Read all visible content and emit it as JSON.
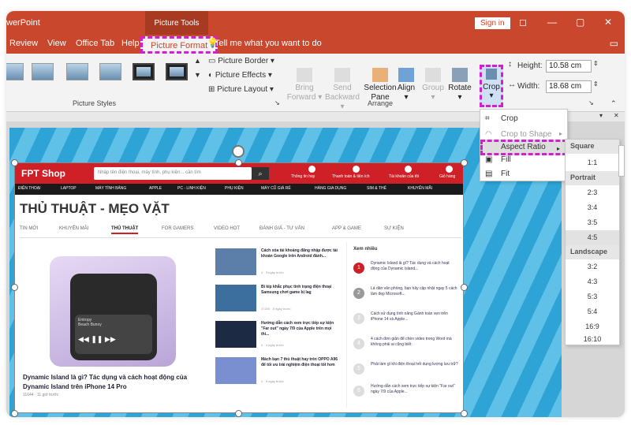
{
  "titlebar": {
    "app": "werPoint",
    "picture_tools": "Picture Tools",
    "sign_in": "Sign in",
    "restore_icon": "◻",
    "minimize_icon": "—",
    "maximize_icon": "▢",
    "close_icon": "✕"
  },
  "tabs": [
    {
      "label": "Review"
    },
    {
      "label": "View"
    },
    {
      "label": "Office Tab"
    },
    {
      "label": "Help"
    },
    {
      "label": "Picture Format"
    }
  ],
  "tell_me": "Tell me what you want to do",
  "ribbon": {
    "picture_border": "Picture Border",
    "picture_effects": "Picture Effects",
    "picture_layout": "Picture Layout",
    "picture_styles_label": "Picture Styles",
    "bring_forward": "Bring",
    "bring_forward_2": "Forward",
    "send_backward": "Send",
    "send_backward_2": "Backward",
    "selection_pane": "Selection",
    "selection_pane_2": "Pane",
    "align": "Align",
    "group": "Group",
    "rotate": "Rotate",
    "arrange_label": "Arrange",
    "crop": "Crop",
    "height_label": "Height:",
    "height_value": "10.58 cm",
    "width_label": "Width:",
    "width_value": "18.68 cm"
  },
  "crop_menu": {
    "crop": "Crop",
    "crop_to_shape": "Crop to Shape",
    "aspect_ratio": "Aspect Ratio",
    "fill": "Fill",
    "fit": "Fit"
  },
  "ratio_menu": {
    "square_header": "Square",
    "square": [
      "1:1"
    ],
    "portrait_header": "Portrait",
    "portrait": [
      "2:3",
      "3:4",
      "3:5",
      "4:5"
    ],
    "landscape_header": "Landscape",
    "landscape": [
      "3:2",
      "4:3",
      "5:3",
      "5:4",
      "16:9",
      "16:10"
    ]
  },
  "site": {
    "logo": "FPT Shop",
    "search_placeholder": "Nhập tên điện thoại, máy tính, phụ kiện... cần tìm",
    "header_links": [
      "Thông tin hay",
      "Thanh toán & tiện ích",
      "Tài khoản của tôi",
      "Giỏ hàng"
    ],
    "nav": [
      "ĐIỆN THOẠI",
      "LAPTOP",
      "MÁY TÍNH BẢNG",
      "APPLE",
      "PC - LINH KIỆN",
      "PHỤ KIỆN",
      "MÁY CŨ GIÁ RẺ",
      "HÀNG GIA DỤNG",
      "SIM & THẺ",
      "KHUYẾN MÃI"
    ],
    "title": "THỦ THUẬT - MẸO VẶT",
    "tabs": [
      "TIN MỚI",
      "KHUYẾN MÃI",
      "THỦ THUẬT",
      "FOR GAMERS",
      "VIDEO HOT",
      "ĐÁNH GIÁ - TƯ VẤN",
      "APP & GAME",
      "SỰ KIỆN"
    ],
    "main_caption": "Dynamic Island là gì? Tác dụng và cách hoạt động của Dynamic Island trên iPhone 14 Pro",
    "main_meta": "11644 · 11 giờ trước",
    "phone_track": "Entropy",
    "phone_artist": "Beach Bunny",
    "mid_articles": [
      {
        "title": "Cách xóa tài khoảng đăng nhập được tài khoản Google trên Android đánh...",
        "meta": "4 · 3 ngày trước"
      },
      {
        "title": "Bí kíp khắc phục tình trạng điện thoại Samsung chơi game bị lag",
        "meta": "47200 · 8 ngày trước"
      },
      {
        "title": "Hướng dẫn cách xem trực tiếp sự kiện \"Far out\" ngày 7/9 của Apple trên mọi thi...",
        "meta": "4 · 4 ngày trước"
      },
      {
        "title": "Mách bạn 7 thủ thuật hay trên OPPO A96 để tối ưu trải nghiệm điện thoại tốt hơn",
        "meta": "4 · 5 ngày trước"
      }
    ],
    "side_title": "Xem nhiều",
    "side_articles": [
      {
        "num": "1",
        "title": "Dynamic Island là gì? Tác dụng và cách hoạt động của Dynamic Island..."
      },
      {
        "num": "2",
        "title": "Lá dân văn phòng, bạn hãy cập nhật ngay 5 cách làm đẹp Microsoft..."
      },
      {
        "num": "3",
        "title": "Cách sử dụng tính năng Gánh toàn vẹn trên iPhone 14 và Apple..."
      },
      {
        "num": "4",
        "title": "4 cách đơn giản để chèn video trong Word mà không phải ai cũng biết"
      },
      {
        "num": "5",
        "title": "Phải làm gì khi điện thoại hết dung lượng lưu trữ?"
      },
      {
        "num": "6",
        "title": "Hướng dẫn cách xem trực tiếp sự kiện \"Far out\" ngày 7/9 của Apple..."
      }
    ]
  },
  "colors": {
    "ribbon_red": "#c9472c",
    "highlight_dashed": "#d21fd2",
    "fpt_red": "#cf2027"
  }
}
